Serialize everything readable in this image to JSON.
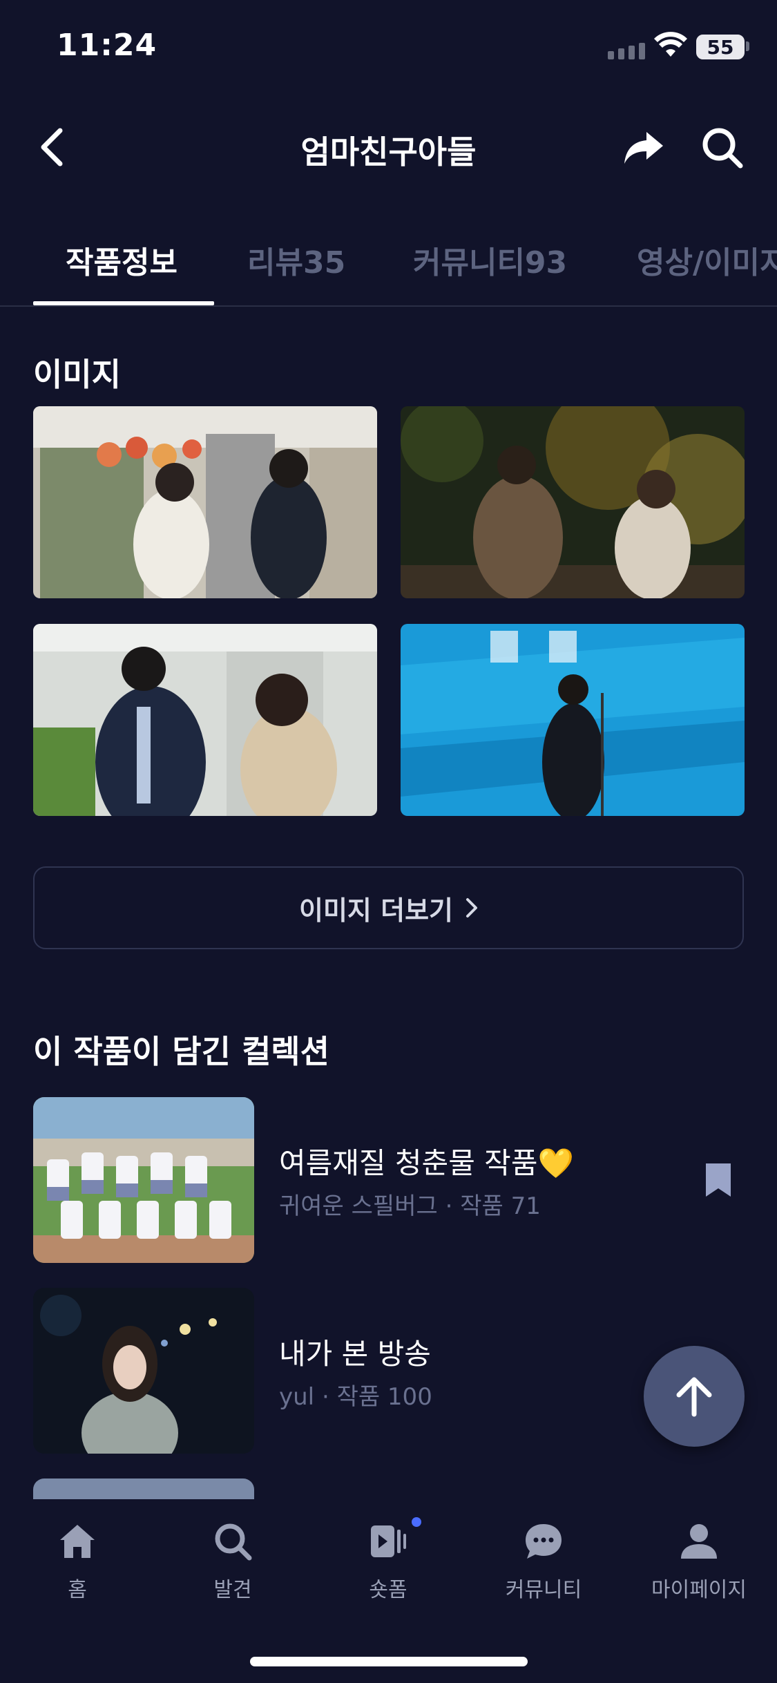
{
  "status_bar": {
    "time": "11:24",
    "battery": "55"
  },
  "header": {
    "title": "엄마친구아들"
  },
  "tabs": [
    {
      "label": "작품정보"
    },
    {
      "label": "리뷰35"
    },
    {
      "label": "커뮤니티93"
    },
    {
      "label": "영상/이미지"
    }
  ],
  "images_section": {
    "title": "이미지",
    "more_label": "이미지 더보기"
  },
  "collections_section": {
    "title": "이 작품이 담긴 컬렉션",
    "items": [
      {
        "name": "여름재질 청춘물 작품💛",
        "owner": "귀여운 스필버그",
        "count": "작품 71"
      },
      {
        "name": "내가 본 방송",
        "owner": "yul",
        "count": "작품 100"
      }
    ]
  },
  "bottom_nav": [
    {
      "label": "홈",
      "icon": "home-icon"
    },
    {
      "label": "발견",
      "icon": "search-icon"
    },
    {
      "label": "숏폼",
      "icon": "shortform-icon"
    },
    {
      "label": "커뮤니티",
      "icon": "chat-bubble-icon"
    },
    {
      "label": "마이페이지",
      "icon": "person-icon"
    }
  ],
  "colors": {
    "background": "#11132a",
    "tab_inactive": "#5d6480",
    "fab": "#4a5478",
    "nav_dot": "#4a6cff"
  }
}
